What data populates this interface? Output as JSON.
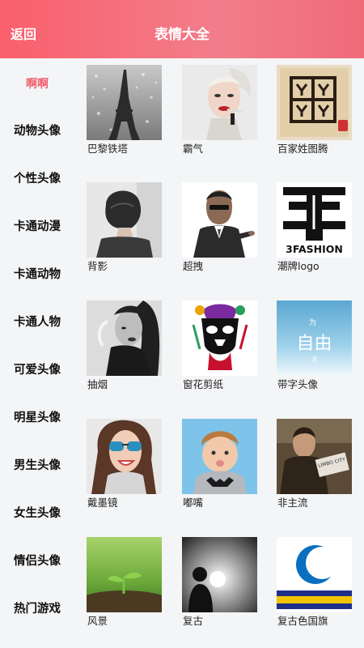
{
  "header": {
    "back_label": "返回",
    "title": "表情大全"
  },
  "colors": {
    "header_gradient_start": "#fa5f6c",
    "header_gradient_end": "#f06b7a",
    "active_category": "#f2606d"
  },
  "sidebar": {
    "active_index": 0,
    "items": [
      {
        "label": "啊啊"
      },
      {
        "label": "动物头像"
      },
      {
        "label": "个性头像"
      },
      {
        "label": "卡通动漫"
      },
      {
        "label": "卡通动物"
      },
      {
        "label": "卡通人物"
      },
      {
        "label": "可爱头像"
      },
      {
        "label": "明星头像"
      },
      {
        "label": "男生头像"
      },
      {
        "label": "女生头像"
      },
      {
        "label": "情侣头像"
      },
      {
        "label": "热门游戏"
      }
    ]
  },
  "grid": {
    "items": [
      {
        "caption": "巴黎铁塔",
        "image": "eiffel-tower-rain-photo"
      },
      {
        "caption": "霸气",
        "image": "woman-smoking-photo"
      },
      {
        "caption": "百家姓图腾",
        "image": "paper-cut-totem"
      },
      {
        "caption": "背影",
        "image": "woman-back-hair-photo"
      },
      {
        "caption": "超拽",
        "image": "man-pointing-photo"
      },
      {
        "caption": "潮牌logo",
        "image": "3fashion-logo",
        "logo_text": "3FASHION"
      },
      {
        "caption": "抽烟",
        "image": "woman-smoke-bw-photo"
      },
      {
        "caption": "窗花剪纸",
        "image": "opera-mask-papercut"
      },
      {
        "caption": "带字头像",
        "image": "freedom-text-sky",
        "overlay_small": "为",
        "overlay_big": "自由",
        "overlay_tail": "活"
      },
      {
        "caption": "戴墨镜",
        "image": "woman-sunglasses-photo"
      },
      {
        "caption": "嘟嘴",
        "image": "boy-pouting-photo"
      },
      {
        "caption": "非主流",
        "image": "man-limbo-city-photo",
        "sign_text": "LIMBO CITY"
      },
      {
        "caption": "风景",
        "image": "sprout-green-photo"
      },
      {
        "caption": "复古",
        "image": "silhouette-sun-photo"
      },
      {
        "caption": "复古色国旗",
        "image": "retro-flag"
      }
    ]
  }
}
